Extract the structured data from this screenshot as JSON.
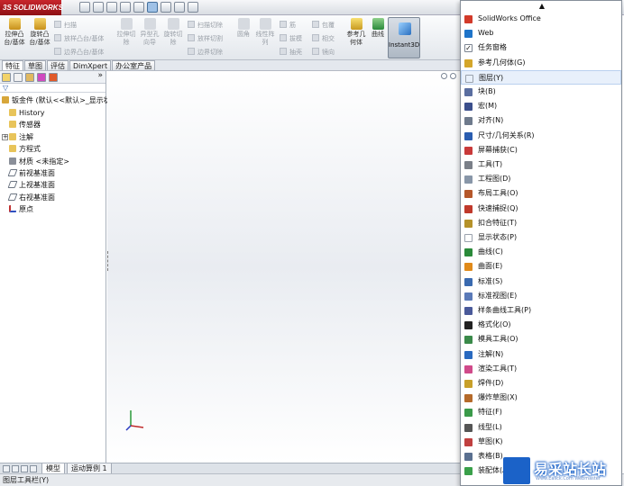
{
  "app": {
    "brand": "SOLIDWORKS",
    "brand_prefix": "3S"
  },
  "ribbon": {
    "extruded_boss": "拉伸凸台/基体",
    "revolved_boss": "旋转凸台/基体",
    "sweep": "扫描",
    "loft": "放样凸台/基体",
    "boundary": "边界凸台/基体",
    "extruded_cut": "拉伸切除",
    "hole_wizard": "异型孔向导",
    "revolved_cut": "旋转切除",
    "swept_cut": "扫描切除",
    "lofted_cut": "放样切割",
    "boundary_cut": "边界切除",
    "fillet": "圆角",
    "linear_pattern": "线性阵列",
    "rib": "筋",
    "draft": "拔模",
    "shell": "抽壳",
    "wrap": "包覆",
    "intersect": "相交",
    "mirror": "镜向",
    "reference_geometry": "参考几何体",
    "curves": "曲线",
    "instant3d": "Instant3D"
  },
  "tabs": [
    "特征",
    "草图",
    "评估",
    "DimXpert",
    "办公室产品"
  ],
  "feature_tree": {
    "root": "钣金件 (默认<<默认>_显示状",
    "items": [
      "History",
      "传感器",
      "注解",
      "方程式",
      "材质 <未指定>",
      "前视基准面",
      "上视基准面",
      "右视基准面",
      "原点"
    ]
  },
  "bottom_tabs": [
    "模型",
    "运动算例 1"
  ],
  "status": "图层工具栏(Y)",
  "menu": {
    "up_arrow": "▲",
    "items": [
      {
        "label": "SolidWorks Office",
        "icon": "solidworks-office-icon",
        "color": "#d23a2a"
      },
      {
        "label": "Web",
        "icon": "globe-icon",
        "color": "#1f74c9"
      },
      {
        "label": "任务窗格",
        "icon": "checkbox-icon",
        "checked": true,
        "color": "#ffffff"
      },
      {
        "label": "参考几何体(G)",
        "icon": "reference-geometry-icon",
        "color": "#d4a62a"
      },
      {
        "label": "图层(Y)",
        "icon": "layer-icon",
        "highlight": true,
        "color": "#ffffff"
      },
      {
        "label": "块(B)",
        "icon": "block-icon",
        "color": "#5a6ea0"
      },
      {
        "label": "宏(M)",
        "icon": "macro-icon",
        "color": "#3b4f8c"
      },
      {
        "label": "对齐(N)",
        "icon": "align-icon",
        "color": "#6e7a8c"
      },
      {
        "label": "尺寸/几何关系(R)",
        "icon": "dimension-icon",
        "color": "#2a5db0"
      },
      {
        "label": "屏幕捕获(C)",
        "icon": "screen-capture-icon",
        "color": "#c93a3a"
      },
      {
        "label": "工具(T)",
        "icon": "tools-icon",
        "color": "#7a7f88"
      },
      {
        "label": "工程图(D)",
        "icon": "drawing-icon",
        "color": "#8896a8"
      },
      {
        "label": "布局工具(O)",
        "icon": "layout-tools-icon",
        "color": "#b5572a"
      },
      {
        "label": "快速捕捉(Q)",
        "icon": "quick-snap-icon",
        "color": "#c0392b"
      },
      {
        "label": "扣合特征(T)",
        "icon": "fastening-feature-icon",
        "color": "#b5922a"
      },
      {
        "label": "显示状态(P)",
        "icon": "display-state-icon",
        "color": "#ffffff"
      },
      {
        "label": "曲线(C)",
        "icon": "curves-icon",
        "color": "#2a8a3a"
      },
      {
        "label": "曲面(E)",
        "icon": "surfaces-icon",
        "color": "#e08a1a"
      },
      {
        "label": "标准(S)",
        "icon": "standard-icon",
        "color": "#3a6ab0"
      },
      {
        "label": "标准视图(E)",
        "icon": "standard-views-icon",
        "color": "#5a7ab8"
      },
      {
        "label": "样条曲线工具(P)",
        "icon": "spline-tools-icon",
        "color": "#4a5a9a"
      },
      {
        "label": "格式化(O)",
        "icon": "format-icon",
        "color": "#222222"
      },
      {
        "label": "模具工具(O)",
        "icon": "mold-tools-icon",
        "color": "#3a8a4a"
      },
      {
        "label": "注解(N)",
        "icon": "annotation-icon",
        "color": "#2a6ac0"
      },
      {
        "label": "渲染工具(T)",
        "icon": "render-tools-icon",
        "color": "#d04a8a"
      },
      {
        "label": "焊件(D)",
        "icon": "weldments-icon",
        "color": "#c8a02a"
      },
      {
        "label": "爆炸草图(X)",
        "icon": "explode-sketch-icon",
        "color": "#b56a2a"
      },
      {
        "label": "特征(F)",
        "icon": "features-icon",
        "color": "#3a9a4a"
      },
      {
        "label": "线型(L)",
        "icon": "line-format-icon",
        "color": "#555555"
      },
      {
        "label": "草图(K)",
        "icon": "sketch-icon",
        "color": "#c04040"
      },
      {
        "label": "表格(B)",
        "icon": "table-icon",
        "color": "#5a7090"
      },
      {
        "label": "装配体(A)",
        "icon": "assembly-icon",
        "color": "#3aa04a"
      }
    ]
  },
  "watermark": {
    "text": "易采站长站",
    "url": "Www.Easck.Com Webmaster"
  }
}
